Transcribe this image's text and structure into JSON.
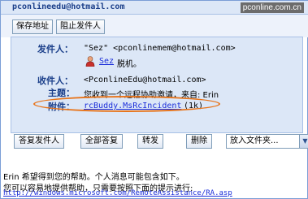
{
  "window": {
    "title": "pconlineedu@hotmail.com",
    "watermark": "pconline.com.cn"
  },
  "top_actions": {
    "save_address": "保存地址",
    "block_sender": "阻止发件人"
  },
  "header": {
    "from_label": "发件人：",
    "from_value": "\"Sez\" <pconlinemem@hotmail.com>",
    "contact_name": "Sez",
    "contact_status": "脱机。",
    "to_label": "收件人：",
    "to_value": "<PconlineEdu@hotmail.com>",
    "subject_label": "主题：",
    "subject_value": "您收到一个远程协助邀请，来自: Erin",
    "attachment_label": "附件：",
    "attachment_name": "rcBuddy.MsRcIncident",
    "attachment_size": "(1k)"
  },
  "reply_bar": {
    "reply_sender": "答复发件人",
    "reply_all": "全部答复",
    "forward": "转发",
    "delete": "删除",
    "move_to_folder": "放入文件夹..."
  },
  "message": {
    "line1": "Erin 希望得到您的帮助。个人消息可能包含如下。",
    "line2": "您可以容易地提供帮助，只需要按照下面的提示进行:",
    "link": "http://windows.microsoft.com/RemoteAssistance/RA.asp"
  },
  "colors": {
    "accent": "#1b3f8a",
    "panel": "#dce7f7",
    "highlight": "#e8741a",
    "link": "#1a2dd9"
  },
  "icons": {
    "contact": "person-icon",
    "dropdown": "chevron-down-icon"
  }
}
